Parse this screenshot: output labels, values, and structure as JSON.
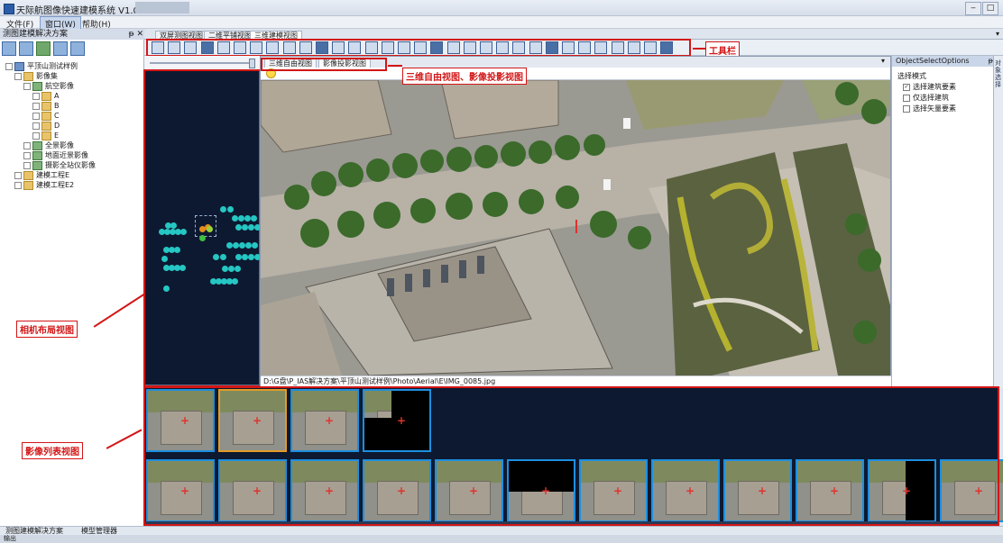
{
  "window": {
    "title": "天际航图像快速建模系统 V1.0",
    "min": "‒",
    "max": "□"
  },
  "menu": [
    "文件(F)",
    "窗口(W)",
    "帮助(H)"
  ],
  "left_panel": {
    "title": "测图建模解决方案",
    "pin": "ᵽ ✕",
    "tree": [
      {
        "label": "平顶山测试样例",
        "indent": 0,
        "icon": "proj"
      },
      {
        "label": "影像集",
        "indent": 1,
        "icon": "folder"
      },
      {
        "label": "航空影像",
        "indent": 2,
        "icon": "img"
      },
      {
        "label": "A",
        "indent": 3,
        "icon": "folder"
      },
      {
        "label": "B",
        "indent": 3,
        "icon": "folder"
      },
      {
        "label": "C",
        "indent": 3,
        "icon": "folder"
      },
      {
        "label": "D",
        "indent": 3,
        "icon": "folder"
      },
      {
        "label": "E",
        "indent": 3,
        "icon": "folder"
      },
      {
        "label": "全景影像",
        "indent": 2,
        "icon": "img"
      },
      {
        "label": "地面近景影像",
        "indent": 2,
        "icon": "img"
      },
      {
        "label": "摄影全站仪影像",
        "indent": 2,
        "icon": "img"
      },
      {
        "label": "建模工程E",
        "indent": 1,
        "icon": "folder"
      },
      {
        "label": "建模工程E2",
        "indent": 1,
        "icon": "folder"
      }
    ]
  },
  "doc_tabs": [
    "双屏测图视图",
    "二维平铺视图",
    "三维建模视图"
  ],
  "view_tabs": [
    "三维自由视图",
    "影像投影视图"
  ],
  "file_path": "D:\\G盘\\P_IAS解决方案\\平顶山测试样例\\Photo\\Aerial\\E\\IMG_0085.jpg",
  "right_panel": {
    "title": "ObjectSelectOptions",
    "pin": "ᵽ",
    "group_label": "选择模式",
    "options": [
      {
        "label": "选择建筑要素",
        "checked": "✓"
      },
      {
        "label": "仅选择建筑",
        "checked": ""
      },
      {
        "label": "选择矢量要素",
        "checked": ""
      }
    ]
  },
  "side_strip": "对象选择",
  "bottom_tabs": [
    "测图建模解决方案",
    "模型管理器"
  ],
  "status": "输出",
  "annotations": {
    "toolbar": "工具栏",
    "view3d": "三维自由视图、影像投影视图",
    "camera_layout": "相机布局视图",
    "image_list": "影像列表视图"
  },
  "colors": {
    "annotation_red": "#d21616",
    "thumb_border": "#1d8fe0",
    "thumb_selected": "#e39b27",
    "camera_point": "#25c6c3"
  }
}
